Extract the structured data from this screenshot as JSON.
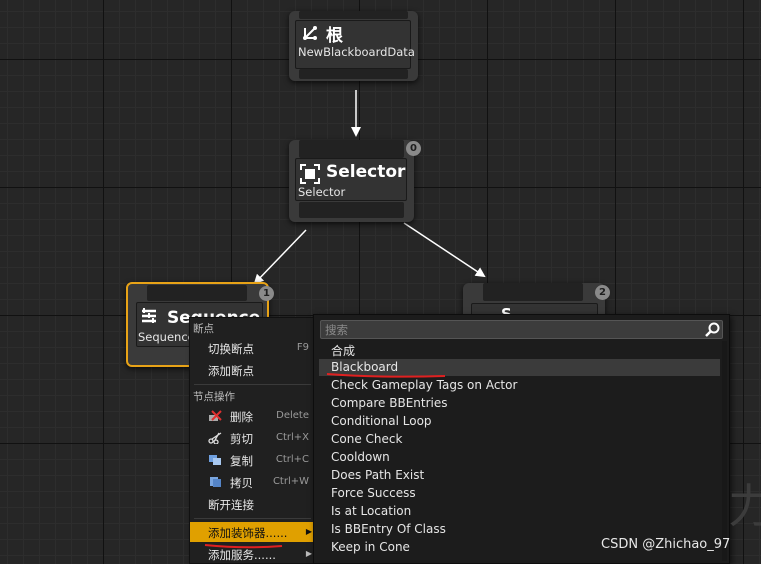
{
  "graph": {
    "root": {
      "title": "根",
      "subtitle": "NewBlackboardData"
    },
    "selector": {
      "title": "Selector",
      "subtitle": "Selector",
      "index": "0"
    },
    "sequence": {
      "title": "Sequence",
      "subtitle": "Sequence",
      "index": "1"
    },
    "right_node": {
      "title": "S",
      "index": "2"
    }
  },
  "context_menu": {
    "section_breakpoint": "断点",
    "toggle_breakpoint": {
      "label": "切换断点",
      "shortcut": "F9"
    },
    "add_breakpoint": {
      "label": "添加断点"
    },
    "section_node_actions": "节点操作",
    "delete": {
      "label": "删除",
      "shortcut": "Delete"
    },
    "cut": {
      "label": "剪切",
      "shortcut": "Ctrl+X"
    },
    "copy": {
      "label": "复制",
      "shortcut": "Ctrl+C"
    },
    "duplicate": {
      "label": "拷贝",
      "shortcut": "Ctrl+W"
    },
    "break_links": {
      "label": "断开连接"
    },
    "add_decorator": {
      "label": "添加装饰器......"
    },
    "add_service": {
      "label": "添加服务......"
    }
  },
  "dropdown": {
    "search_placeholder": "搜索",
    "category": "合成",
    "items": [
      "Blackboard",
      "Check Gameplay Tags on Actor",
      "Compare BBEntries",
      "Conditional Loop",
      "Cone Check",
      "Cooldown",
      "Does Path Exist",
      "Force Success",
      "Is at Location",
      "Is BBEntry Of Class",
      "Keep in Cone"
    ],
    "selected": "Blackboard"
  },
  "watermark": "CSDN @Zhichao_97",
  "colors": {
    "highlight": "#e0a000",
    "selected_border": "#e8a317",
    "annotation_red": "#e02020"
  }
}
